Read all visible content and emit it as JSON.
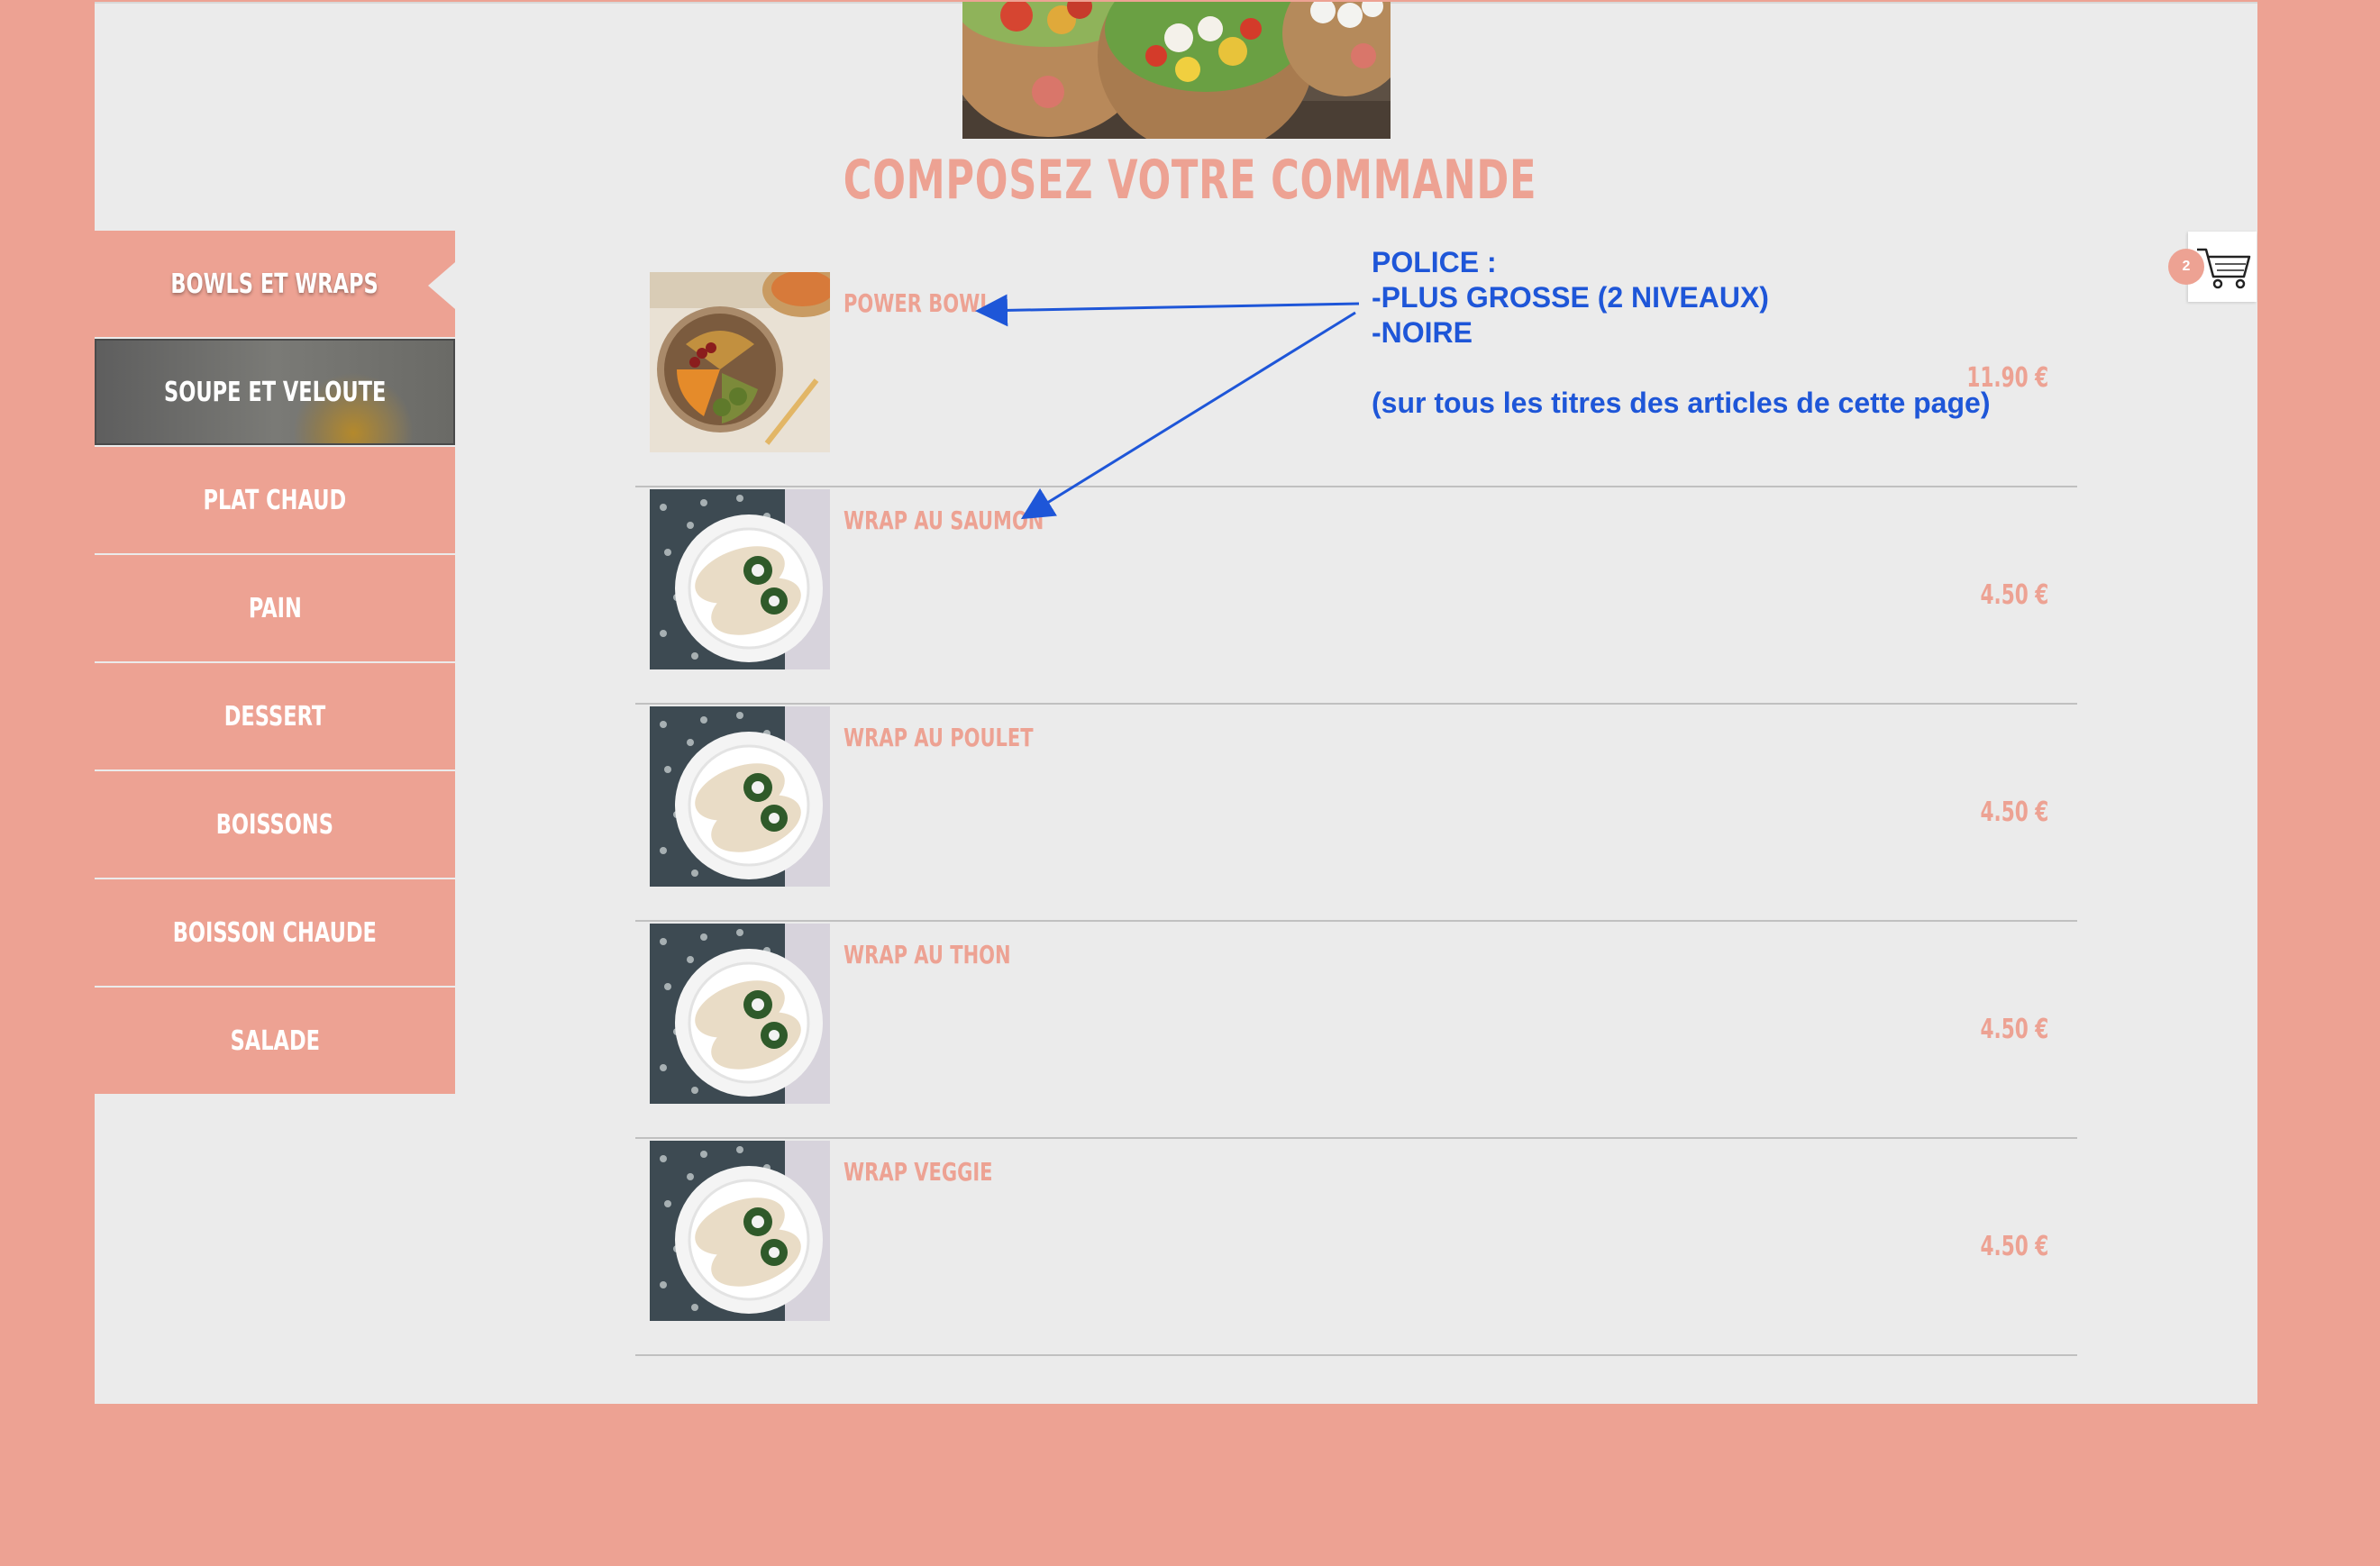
{
  "page": {
    "title": "COMPOSEZ VOTRE COMMANDE"
  },
  "sidebar": {
    "items": [
      {
        "label": "BOWLS ET WRAPS",
        "state": "active"
      },
      {
        "label": "SOUPE ET VELOUTE",
        "state": "photo"
      },
      {
        "label": "PLAT CHAUD"
      },
      {
        "label": "PAIN"
      },
      {
        "label": "DESSERT"
      },
      {
        "label": "BOISSONS"
      },
      {
        "label": "BOISSON CHAUDE"
      },
      {
        "label": "SALADE"
      }
    ]
  },
  "products": [
    {
      "name": "POWER BOWL",
      "price": "11.90 €",
      "image": "bowl"
    },
    {
      "name": "WRAP AU SAUMON",
      "price": "4.50 €",
      "image": "wrap"
    },
    {
      "name": "WRAP AU POULET",
      "price": "4.50 €",
      "image": "wrap"
    },
    {
      "name": "WRAP AU THON",
      "price": "4.50 €",
      "image": "wrap"
    },
    {
      "name": "WRAP VEGGIE",
      "price": "4.50 €",
      "image": "wrap"
    }
  ],
  "cart": {
    "count": "2",
    "icon": "shopping-cart-icon"
  },
  "annotation": {
    "lines": [
      "POLICE :",
      "-PLUS GROSSE (2 NIVEAUX)",
      "-NOIRE",
      "",
      "(sur tous les titres des articles de cette page)"
    ],
    "color": "#1e56d8"
  },
  "colors": {
    "accent": "#eda293",
    "panel": "#ebebeb",
    "annotation": "#1e56d8"
  }
}
